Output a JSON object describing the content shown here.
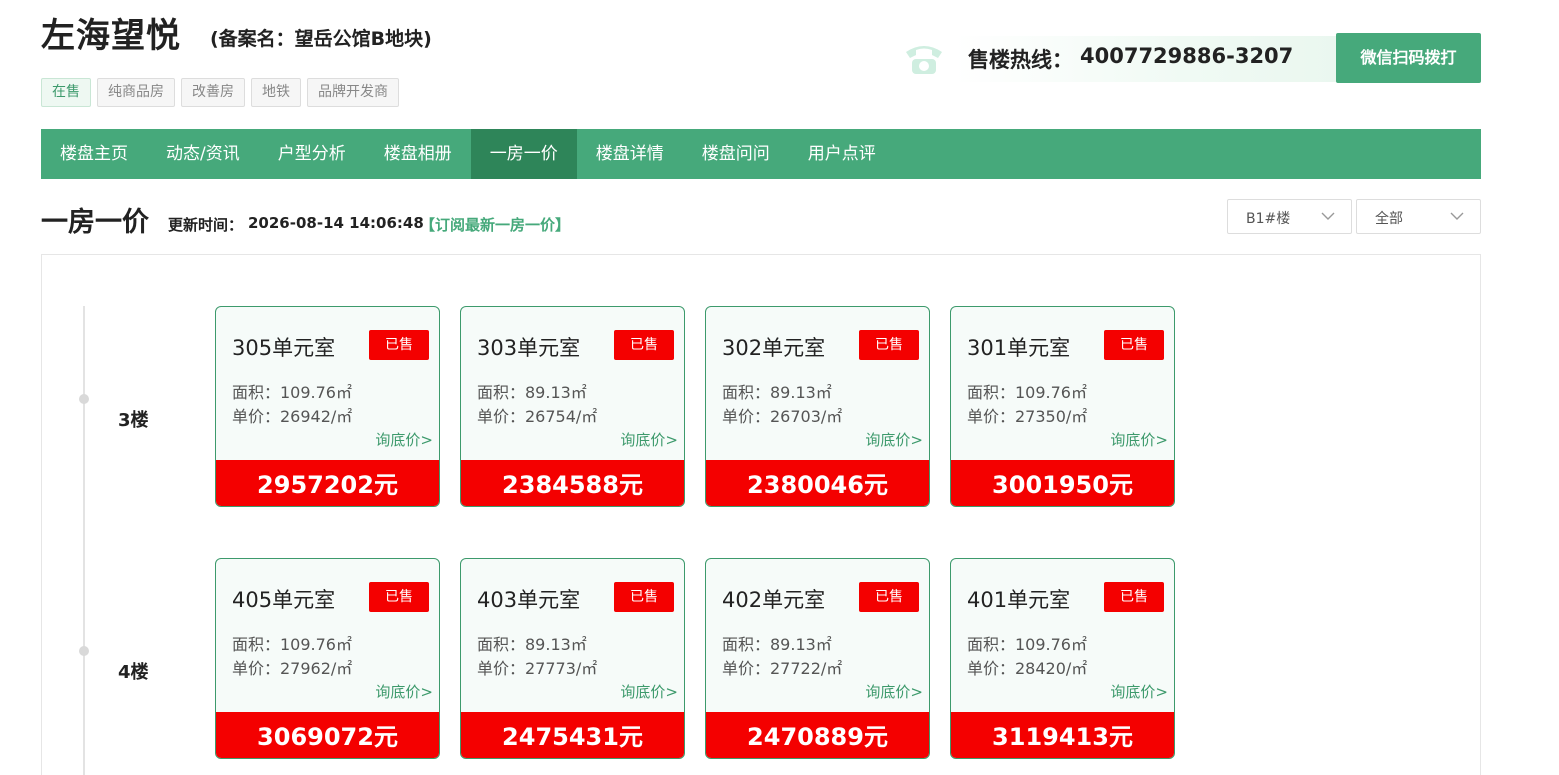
{
  "header": {
    "title": "左海望悦",
    "record_name": "(备案名：望岳公馆B地块)",
    "tags": [
      "在售",
      "纯商品房",
      "改善房",
      "地铁",
      "品牌开发商"
    ],
    "hotline_label": "售楼热线：",
    "hotline_number": "4007729886-3207",
    "dial_button": "微信扫码拨打"
  },
  "nav": {
    "items": [
      "楼盘主页",
      "动态/资讯",
      "户型分析",
      "楼盘相册",
      "一房一价",
      "楼盘详情",
      "楼盘问问",
      "用户点评"
    ],
    "active": "一房一价"
  },
  "section": {
    "title": "一房一价",
    "update_label": "更新时间：",
    "update_time": "2026-08-14 14:06:48",
    "subscribe": "【订阅最新一房一价】",
    "building_select": "B1#楼",
    "filter_select": "全部"
  },
  "colors": {
    "brand_green": "#46a97b",
    "active_green": "#2e8559",
    "sold_red": "#f40000"
  },
  "floors": [
    {
      "label": "3楼",
      "units": [
        {
          "room": "305单元室",
          "status": "已售",
          "area": "面积：109.76㎡",
          "unit_price": "单价：26942/㎡",
          "inquire": "询底价>",
          "total": "2957202元"
        },
        {
          "room": "303单元室",
          "status": "已售",
          "area": "面积：89.13㎡",
          "unit_price": "单价：26754/㎡",
          "inquire": "询底价>",
          "total": "2384588元"
        },
        {
          "room": "302单元室",
          "status": "已售",
          "area": "面积：89.13㎡",
          "unit_price": "单价：26703/㎡",
          "inquire": "询底价>",
          "total": "2380046元"
        },
        {
          "room": "301单元室",
          "status": "已售",
          "area": "面积：109.76㎡",
          "unit_price": "单价：27350/㎡",
          "inquire": "询底价>",
          "total": "3001950元"
        }
      ]
    },
    {
      "label": "4楼",
      "units": [
        {
          "room": "405单元室",
          "status": "已售",
          "area": "面积：109.76㎡",
          "unit_price": "单价：27962/㎡",
          "inquire": "询底价>",
          "total": "3069072元"
        },
        {
          "room": "403单元室",
          "status": "已售",
          "area": "面积：89.13㎡",
          "unit_price": "单价：27773/㎡",
          "inquire": "询底价>",
          "total": "2475431元"
        },
        {
          "room": "402单元室",
          "status": "已售",
          "area": "面积：89.13㎡",
          "unit_price": "单价：27722/㎡",
          "inquire": "询底价>",
          "total": "2470889元"
        },
        {
          "room": "401单元室",
          "status": "已售",
          "area": "面积：109.76㎡",
          "unit_price": "单价：28420/㎡",
          "inquire": "询底价>",
          "total": "3119413元"
        }
      ]
    }
  ]
}
